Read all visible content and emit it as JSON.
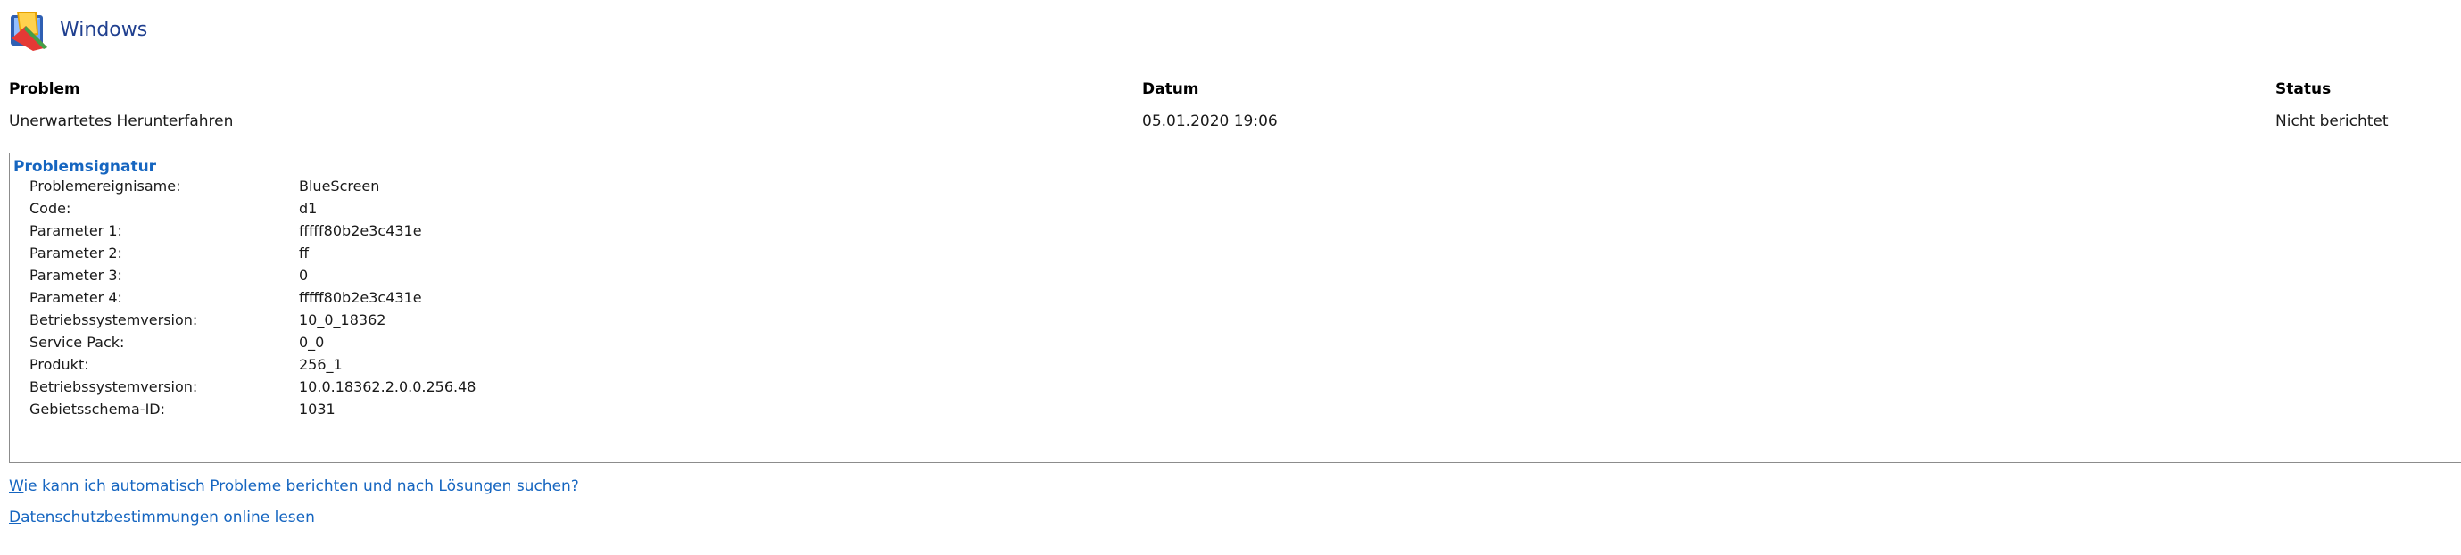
{
  "header": {
    "title": "Windows",
    "logo_icon": "windows-problem-report-icon"
  },
  "columns": {
    "problem_header": "Problem",
    "date_header": "Datum",
    "status_header": "Status"
  },
  "entry": {
    "problem": "Unerwartetes Herunterfahren",
    "date": "05.01.2020 19:06",
    "status": "Nicht berichtet"
  },
  "signature": {
    "title": "Problemsignatur",
    "rows": [
      {
        "label": "Problemereignisame:",
        "value": "BlueScreen"
      },
      {
        "label": "Code:",
        "value": "d1"
      },
      {
        "label": "Parameter 1:",
        "value": "fffff80b2e3c431e"
      },
      {
        "label": "Parameter 2:",
        "value": "ff"
      },
      {
        "label": "Parameter 3:",
        "value": "0"
      },
      {
        "label": "Parameter 4:",
        "value": "fffff80b2e3c431e"
      },
      {
        "label": "Betriebssystemversion:",
        "value": "10_0_18362"
      },
      {
        "label": "Service Pack:",
        "value": "0_0"
      },
      {
        "label": "Produkt:",
        "value": "256_1"
      },
      {
        "label": "Betriebssystemversion:",
        "value": "10.0.18362.2.0.0.256.48"
      },
      {
        "label": "Gebietsschema-ID:",
        "value": "1031"
      }
    ]
  },
  "links": {
    "auto_report_first_letter": "W",
    "auto_report_rest": "ie kann ich automatisch Probleme berichten und nach Lösungen suchen?",
    "privacy_first_letter": "D",
    "privacy_rest": "atenschutzbestimmungen online lesen"
  },
  "colors": {
    "title_blue": "#1f3f8f",
    "link_blue": "#1565c0",
    "border": "#8c8c8c"
  }
}
